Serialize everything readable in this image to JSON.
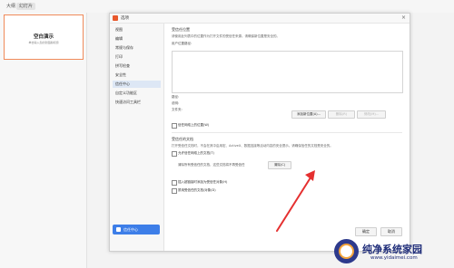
{
  "top_tabs": [
    {
      "label": "大纲"
    },
    {
      "label": "幻灯片"
    }
  ],
  "slide_thumb": {
    "title": "空白演示",
    "subtitle": "单击输入您的封面副标题"
  },
  "dialog": {
    "title": "选项",
    "close_glyph": "×",
    "nav_items": [
      {
        "label": "视图"
      },
      {
        "label": "编辑"
      },
      {
        "label": "常规与保存"
      },
      {
        "label": "打印"
      },
      {
        "label": "拼写检查"
      },
      {
        "label": "安全性"
      },
      {
        "label": "信任中心"
      },
      {
        "label": "自定义功能区"
      },
      {
        "label": "快速访问工具栏"
      }
    ],
    "nav_footer": "信任中心",
    "trusted_locations": {
      "title": "受信任位置",
      "desc": "请使用此列表中的位置作为打开文件的受信任来源。请确保新位置是安全的。",
      "path_label": "用户位置路径:",
      "path_field": "路径:",
      "desc_field": "说明:",
      "modify_label": "文件夹:",
      "add_button": "添加新位置(A)...",
      "delete_button": "删除(R)",
      "modify_button": "修改(M)...",
      "allow_network": "信任网络上的位置(W)"
    },
    "trusted_docs": {
      "title": "受信任的文档",
      "desc": "打开受信任文档时，不会在其中启用宏、ActiveX、数据连接等活动内容的安全提示。请确保信任的文档是安全的。",
      "option1": "允许信任网络上的文档(T)",
      "clear_label": "清除所有受信任的文档，这些文档将不再受信任",
      "clear_button": "清除(C)",
      "option2": "插入超链接时添加为受信任对象(H)",
      "option3": "禁用受信任的文档/对象(D)"
    },
    "ok_button": "确定",
    "cancel_button": "取消"
  },
  "watermark": {
    "title": "纯净系统家园",
    "url": "www.yidaimei.com"
  },
  "colors": {
    "accent": "#3d7ee8",
    "arrow": "#e53030",
    "slide_border": "#f08a5a"
  }
}
